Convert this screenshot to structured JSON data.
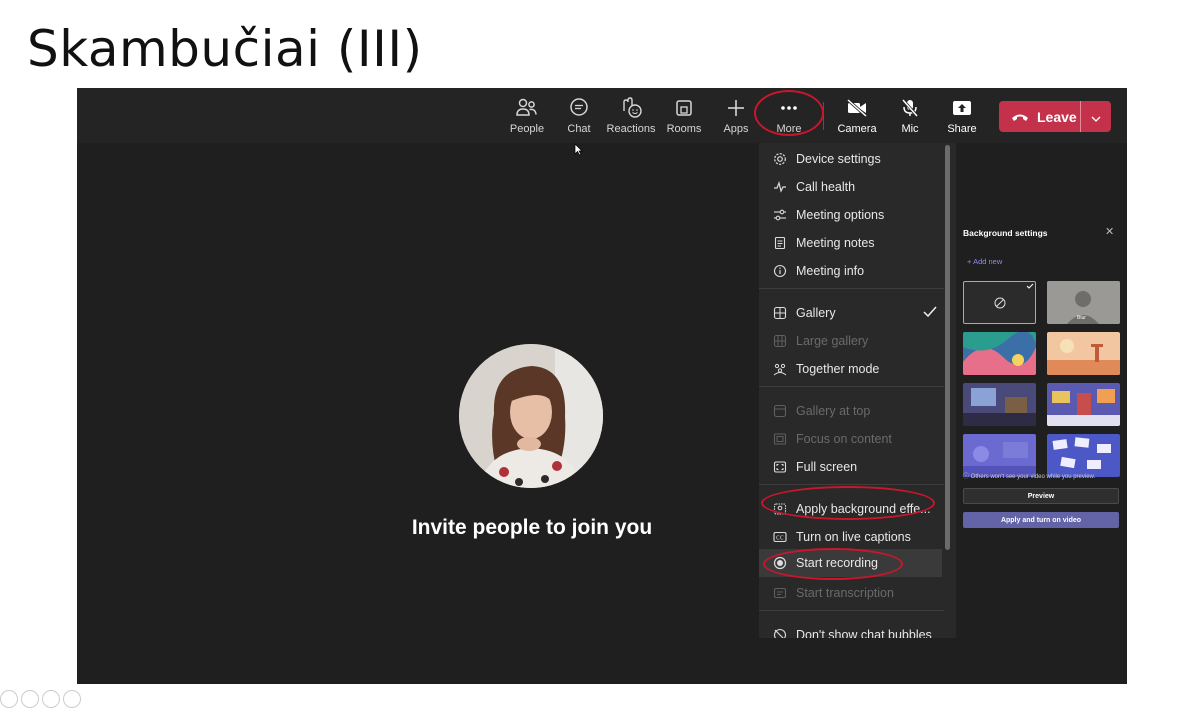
{
  "slide": {
    "title": "Skambučiai (III)"
  },
  "toolbar": {
    "buttons": [
      {
        "label": "People",
        "icon": "people-icon"
      },
      {
        "label": "Chat",
        "icon": "chat-icon"
      },
      {
        "label": "Reactions",
        "icon": "reactions-icon"
      },
      {
        "label": "Rooms",
        "icon": "rooms-icon"
      },
      {
        "label": "Apps",
        "icon": "plus-icon"
      },
      {
        "label": "More",
        "icon": "more-icon"
      },
      {
        "label": "Camera",
        "icon": "camera-off-icon"
      },
      {
        "label": "Mic",
        "icon": "mic-off-icon"
      },
      {
        "label": "Share",
        "icon": "share-icon"
      }
    ],
    "leave_label": "Leave"
  },
  "stage": {
    "invite_text": "Invite people to join you"
  },
  "more_menu": {
    "items": [
      {
        "label": "Device settings",
        "icon": "gear-icon",
        "enabled": true
      },
      {
        "label": "Call health",
        "icon": "pulse-icon",
        "enabled": true
      },
      {
        "label": "Meeting options",
        "icon": "sliders-icon",
        "enabled": true
      },
      {
        "label": "Meeting notes",
        "icon": "notes-icon",
        "enabled": true
      },
      {
        "label": "Meeting info",
        "icon": "info-icon",
        "enabled": true
      },
      {
        "label": "Gallery",
        "icon": "gallery-icon",
        "enabled": true,
        "checked": true
      },
      {
        "label": "Large gallery",
        "icon": "large-gallery-icon",
        "enabled": false
      },
      {
        "label": "Together mode",
        "icon": "together-icon",
        "enabled": true
      },
      {
        "label": "Gallery at top",
        "icon": "gallery-top-icon",
        "enabled": false
      },
      {
        "label": "Focus on content",
        "icon": "focus-icon",
        "enabled": false
      },
      {
        "label": "Full screen",
        "icon": "fullscreen-icon",
        "enabled": true
      },
      {
        "label": "Apply background effe...",
        "icon": "background-icon",
        "enabled": true
      },
      {
        "label": "Turn on live captions",
        "icon": "captions-icon",
        "enabled": true
      },
      {
        "label": "Start recording",
        "icon": "record-icon",
        "enabled": true
      },
      {
        "label": "Start transcription",
        "icon": "transcription-icon",
        "enabled": false
      },
      {
        "label": "Don't show chat bubbles",
        "icon": "chat-bubble-off-icon",
        "enabled": true
      }
    ]
  },
  "background_settings": {
    "title": "Background settings",
    "add_new": "Add new",
    "blur_label": "Blur",
    "note": "Others won't see your video while you preview.",
    "preview_button": "Preview",
    "apply_button": "Apply and turn on video"
  },
  "colors": {
    "leave": "#c4314b",
    "accent": "#6264a7",
    "annotation": "#c8172c"
  }
}
